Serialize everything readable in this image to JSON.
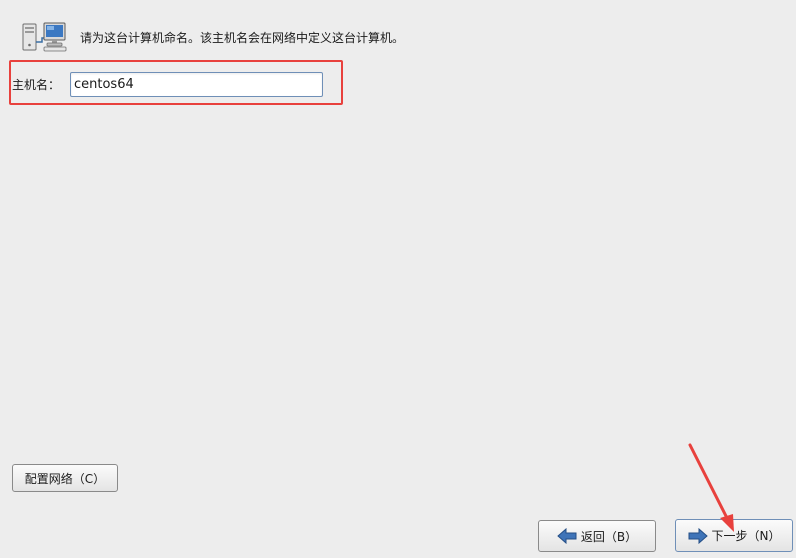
{
  "header": {
    "icon": "network-computers-icon",
    "description": "请为这台计算机命名。该主机名会在网络中定义这台计算机。"
  },
  "hostname": {
    "label": "主机名：",
    "value": "centos64"
  },
  "buttons": {
    "configure_network": "配置网络（C）",
    "back": "返回（B）",
    "next": "下一步（N）"
  },
  "annotations": {
    "highlight_color": "#e8413d"
  }
}
